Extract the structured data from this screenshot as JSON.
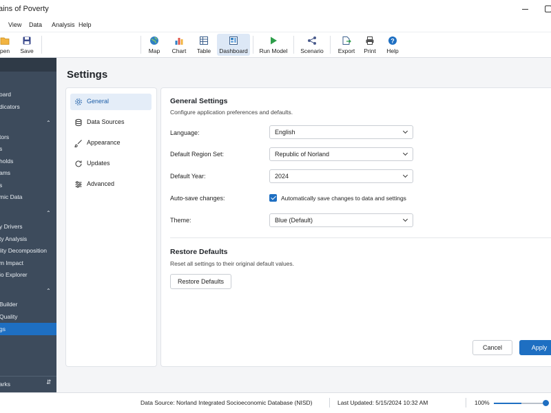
{
  "window": {
    "title": "ains of Poverty"
  },
  "menu": {
    "items": [
      "View",
      "Data",
      "Analysis",
      "Help"
    ]
  },
  "toolbar": {
    "buttons": [
      {
        "label": "pen",
        "icon": "folder-icon"
      },
      {
        "label": "Save",
        "icon": "save-icon"
      },
      {
        "label": "Map",
        "icon": "globe-icon"
      },
      {
        "label": "Chart",
        "icon": "bar-chart-icon"
      },
      {
        "label": "Table",
        "icon": "table-icon"
      },
      {
        "label": "Dashboard",
        "icon": "dashboard-icon",
        "active": true
      },
      {
        "label": "Run Model",
        "icon": "play-icon"
      },
      {
        "label": "Scenario",
        "icon": "scenario-icon"
      },
      {
        "label": "Export",
        "icon": "export-icon"
      },
      {
        "label": "Print",
        "icon": "printer-icon"
      },
      {
        "label": "Help",
        "icon": "help-icon"
      }
    ]
  },
  "sidebar": {
    "items": [
      "oard",
      "dicators",
      "tors",
      "s",
      "holds",
      "ams",
      "s",
      "mic Data",
      "y Drivers",
      "ty Analysis",
      "lity Decomposition",
      "m Impact",
      "io Explorer",
      "Builder",
      "Quality",
      "gs",
      "arks"
    ],
    "active_item": "gs"
  },
  "page": {
    "title": "Settings"
  },
  "settings_nav": {
    "items": [
      {
        "label": "General",
        "icon": "gear-icon"
      },
      {
        "label": "Data Sources",
        "icon": "database-icon"
      },
      {
        "label": "Appearance",
        "icon": "brush-icon"
      },
      {
        "label": "Updates",
        "icon": "refresh-icon"
      },
      {
        "label": "Advanced",
        "icon": "sliders-icon"
      }
    ],
    "active": "General"
  },
  "general": {
    "title": "General Settings",
    "description": "Configure application preferences and defaults.",
    "language": {
      "label": "Language:",
      "value": "English"
    },
    "region": {
      "label": "Default Region Set:",
      "value": "Republic of Norland"
    },
    "year": {
      "label": "Default Year:",
      "value": "2024"
    },
    "autosave": {
      "label": "Auto-save changes:",
      "checkbox_label": "Automatically save changes to data and settings",
      "checked": true
    },
    "theme": {
      "label": "Theme:",
      "value": "Blue (Default)"
    }
  },
  "restore": {
    "title": "Restore Defaults",
    "description": "Reset all settings to their original default values.",
    "button": "Restore Defaults"
  },
  "actions": {
    "cancel": "Cancel",
    "apply": "Apply"
  },
  "status": {
    "data_source": "Data Source: Norland Integrated Socioeconomic Database (NISD)",
    "last_updated": "Last Updated: 5/15/2024 10:32 AM",
    "zoom": "100%",
    "zoom_fraction": 0.5
  },
  "colors": {
    "accent": "#1e6fc2",
    "sidebar": "#3d4b5c"
  }
}
